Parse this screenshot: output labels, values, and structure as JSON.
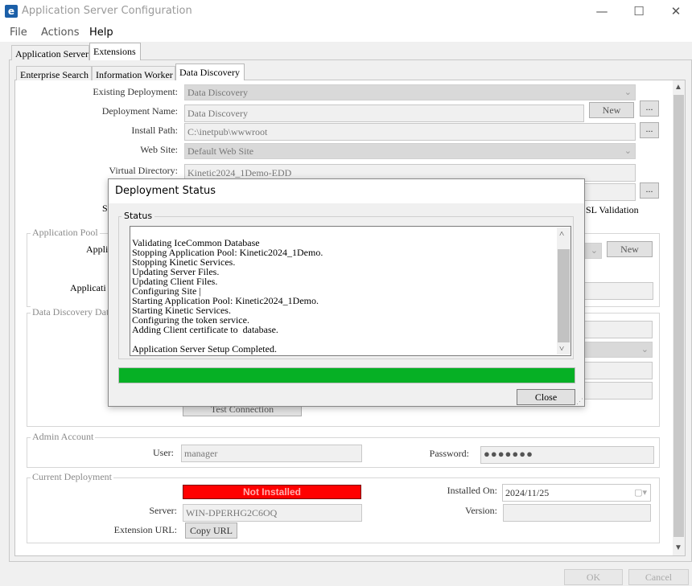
{
  "window": {
    "title": "Application Server Configuration",
    "logo": "e",
    "minimize": "—",
    "maximize": "☐",
    "close": "✕"
  },
  "menu": {
    "file": "File",
    "actions": "Actions",
    "help": "Help"
  },
  "top_tabs": {
    "app_server": "Application Server",
    "extensions": "Extensions"
  },
  "sub_tabs": {
    "enterprise_search": "Enterprise Search",
    "info_worker": "Information Worker",
    "data_discovery": "Data Discovery"
  },
  "form": {
    "existing_deployment_label": "Existing Deployment:",
    "existing_deployment_value": "Data Discovery",
    "deployment_name_label": "Deployment Name:",
    "deployment_name_value": "Data Discovery",
    "new_label": "New",
    "ellipsis": "...",
    "install_path_label": "Install Path:",
    "install_path_value": "C:\\inetpub\\wwwroot",
    "web_site_label": "Web Site:",
    "web_site_value": "Default Web Site",
    "virtual_dir_label": "Virtual Directory:",
    "virtual_dir_value": "Kinetic2024_1Demo-EDD",
    "ssl_partial_left": "S",
    "ssl_partial_right": "SL Validation"
  },
  "app_pool": {
    "title": "Application Pool",
    "label1_partial": "Applic",
    "label2_partial": "Applicati",
    "new_label": "New"
  },
  "dd_db": {
    "title_partial": "Data Discovery Data",
    "test_conn_partial": "Test Connection"
  },
  "admin": {
    "title": "Admin Account",
    "user_label": "User:",
    "user_value": "manager",
    "password_label": "Password:",
    "password_value": "●●●●●●●"
  },
  "current": {
    "title": "Current Deployment",
    "status": "Not Installed",
    "status_color": "#ff0000",
    "installed_on_label": "Installed On:",
    "installed_on_value": "2024/11/25",
    "server_label": "Server:",
    "server_value": "WIN-DPERHG2C6OQ",
    "version_label": "Version:",
    "version_value": "",
    "ext_url_label": "Extension URL:",
    "copy_url": "Copy URL"
  },
  "footer": {
    "ok": "OK",
    "cancel": "Cancel"
  },
  "dialog": {
    "title": "Deployment Status",
    "group": "Status",
    "log": [
      "",
      "Validating IceCommon Database",
      "Stopping Application Pool: Kinetic2024_1Demo.",
      "Stopping Kinetic Services.",
      "Updating Server Files.",
      "Updating Client Files.",
      "Configuring Site |",
      "Starting Application Pool: Kinetic2024_1Demo.",
      "Starting Kinetic Services.",
      "Configuring the token service.",
      "Adding Client certificate to  database.",
      "",
      "Application Server Setup Completed."
    ],
    "progress_fraction": 1.0,
    "progress_color": "#06b025",
    "close": "Close"
  }
}
